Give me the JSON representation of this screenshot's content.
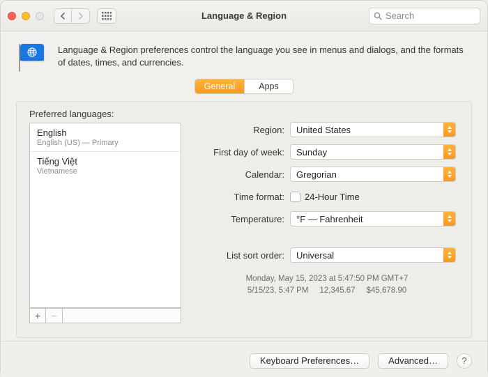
{
  "window": {
    "title": "Language & Region",
    "search_placeholder": "Search"
  },
  "header": {
    "description": "Language & Region preferences control the language you see in menus and dialogs, and the formats of dates, times, and currencies."
  },
  "tabs": {
    "general": "General",
    "apps": "Apps",
    "active_index": 0
  },
  "preferred_languages": {
    "title": "Preferred languages:",
    "items": [
      {
        "name": "English",
        "detail": "English (US) — Primary"
      },
      {
        "name": "Tiếng Việt",
        "detail": "Vietnamese"
      }
    ],
    "add_label": "+",
    "remove_label": "−"
  },
  "settings": {
    "region": {
      "label": "Region:",
      "value": "United States"
    },
    "first_day": {
      "label": "First day of week:",
      "value": "Sunday"
    },
    "calendar": {
      "label": "Calendar:",
      "value": "Gregorian"
    },
    "time_format": {
      "label": "Time format:",
      "checkbox_label": "24-Hour Time",
      "checked": false
    },
    "temperature": {
      "label": "Temperature:",
      "value": "°F — Fahrenheit"
    },
    "sort_order": {
      "label": "List sort order:",
      "value": "Universal"
    }
  },
  "examples": {
    "long": "Monday, May 15, 2023 at 5:47:50 PM GMT+7",
    "short_date": "5/15/23, 5:47 PM",
    "number": "12,345.67",
    "currency": "$45,678.90"
  },
  "footer": {
    "keyboard": "Keyboard Preferences…",
    "advanced": "Advanced…",
    "help": "?"
  }
}
